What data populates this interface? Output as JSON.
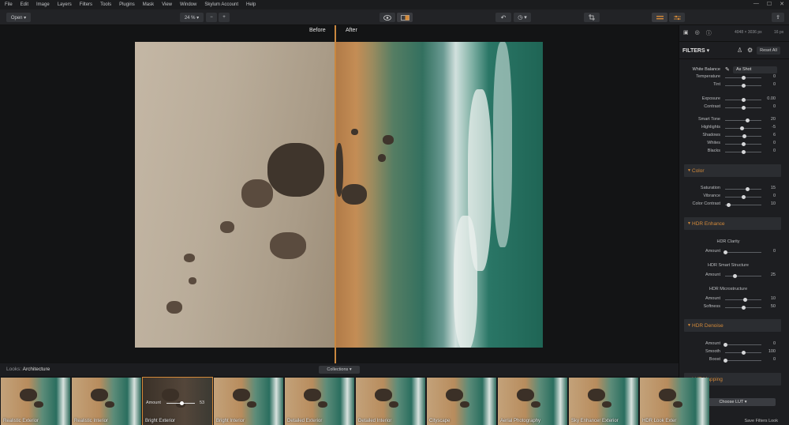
{
  "menu": [
    "File",
    "Edit",
    "Image",
    "Layers",
    "Filters",
    "Tools",
    "Plugins",
    "Mask",
    "View",
    "Window",
    "Skylum Account",
    "Help"
  ],
  "toolbar": {
    "open_label": "Open ▾",
    "zoom_label": "24 % ▾",
    "zoom_out": "−",
    "zoom_in": "+"
  },
  "canvas": {
    "before_label": "Before",
    "after_label": "After"
  },
  "panel": {
    "dimensions": "4048 × 3036 px",
    "size": "16 px",
    "filters_title": "FILTERS ▾",
    "reset_label": "Reset All",
    "white_balance": {
      "label": "White Balance",
      "value": "As Shot"
    },
    "essentials": [
      {
        "label": "Temperature",
        "value": "0",
        "pos": 0.5
      },
      {
        "label": "Tint",
        "value": "0",
        "pos": 0.5
      }
    ],
    "exposure": [
      {
        "label": "Exposure",
        "value": "0.00",
        "pos": 0.5
      },
      {
        "label": "Contrast",
        "value": "0",
        "pos": 0.5
      }
    ],
    "tone": [
      {
        "label": "Smart Tone",
        "value": "20",
        "pos": 0.6
      },
      {
        "label": "Highlights",
        "value": "-5",
        "pos": 0.46
      },
      {
        "label": "Shadows",
        "value": "6",
        "pos": 0.53
      },
      {
        "label": "Whites",
        "value": "0",
        "pos": 0.5
      },
      {
        "label": "Blacks",
        "value": "0",
        "pos": 0.5
      }
    ],
    "color_title": "Color",
    "color": [
      {
        "label": "Saturation",
        "value": "15",
        "pos": 0.6
      },
      {
        "label": "Vibrance",
        "value": "0",
        "pos": 0.5
      },
      {
        "label": "Color Contrast",
        "value": "10",
        "pos": 0.08
      }
    ],
    "hdr_title": "HDR Enhance",
    "hdr_clarity": "HDR Clarity",
    "hdr_clarity_amount": {
      "label": "Amount",
      "value": "0",
      "pos": 0.0
    },
    "hdr_smart": "HDR Smart Structure",
    "hdr_smart_amount": {
      "label": "Amount",
      "value": "25",
      "pos": 0.25
    },
    "hdr_micro": "HDR Microstructure",
    "hdr_micro_rows": [
      {
        "label": "Amount",
        "value": "10",
        "pos": 0.55
      },
      {
        "label": "Softness",
        "value": "50",
        "pos": 0.5
      }
    ],
    "denoise_title": "HDR Denoise",
    "denoise": [
      {
        "label": "Amount",
        "value": "0",
        "pos": 0.0
      },
      {
        "label": "Smooth",
        "value": "100",
        "pos": 0.5
      },
      {
        "label": "Boost",
        "value": "0",
        "pos": 0.0
      }
    ],
    "lut_title": "LUT Mapping",
    "lut_button": "Choose LUT ▾",
    "save_look": "Save Filters Look"
  },
  "looks": {
    "prefix": "Looks:",
    "category": "Architecture",
    "collections": "Collections ▾",
    "amount_label": "Amount",
    "amount_value": "53",
    "amount_pos": 0.53,
    "items": [
      "Realistic Exterior",
      "Realistic Interior",
      "Bright Exterior",
      "Bright Interior",
      "Detailed Exterior",
      "Detailed Interior",
      "Cityscape",
      "Aerial Photography",
      "Sky Enhancer Exterior",
      "HDR Look Exter"
    ]
  },
  "colors": {
    "accent": "#d48a3a",
    "panel": "#1d1e21",
    "canvas": "#131415"
  }
}
